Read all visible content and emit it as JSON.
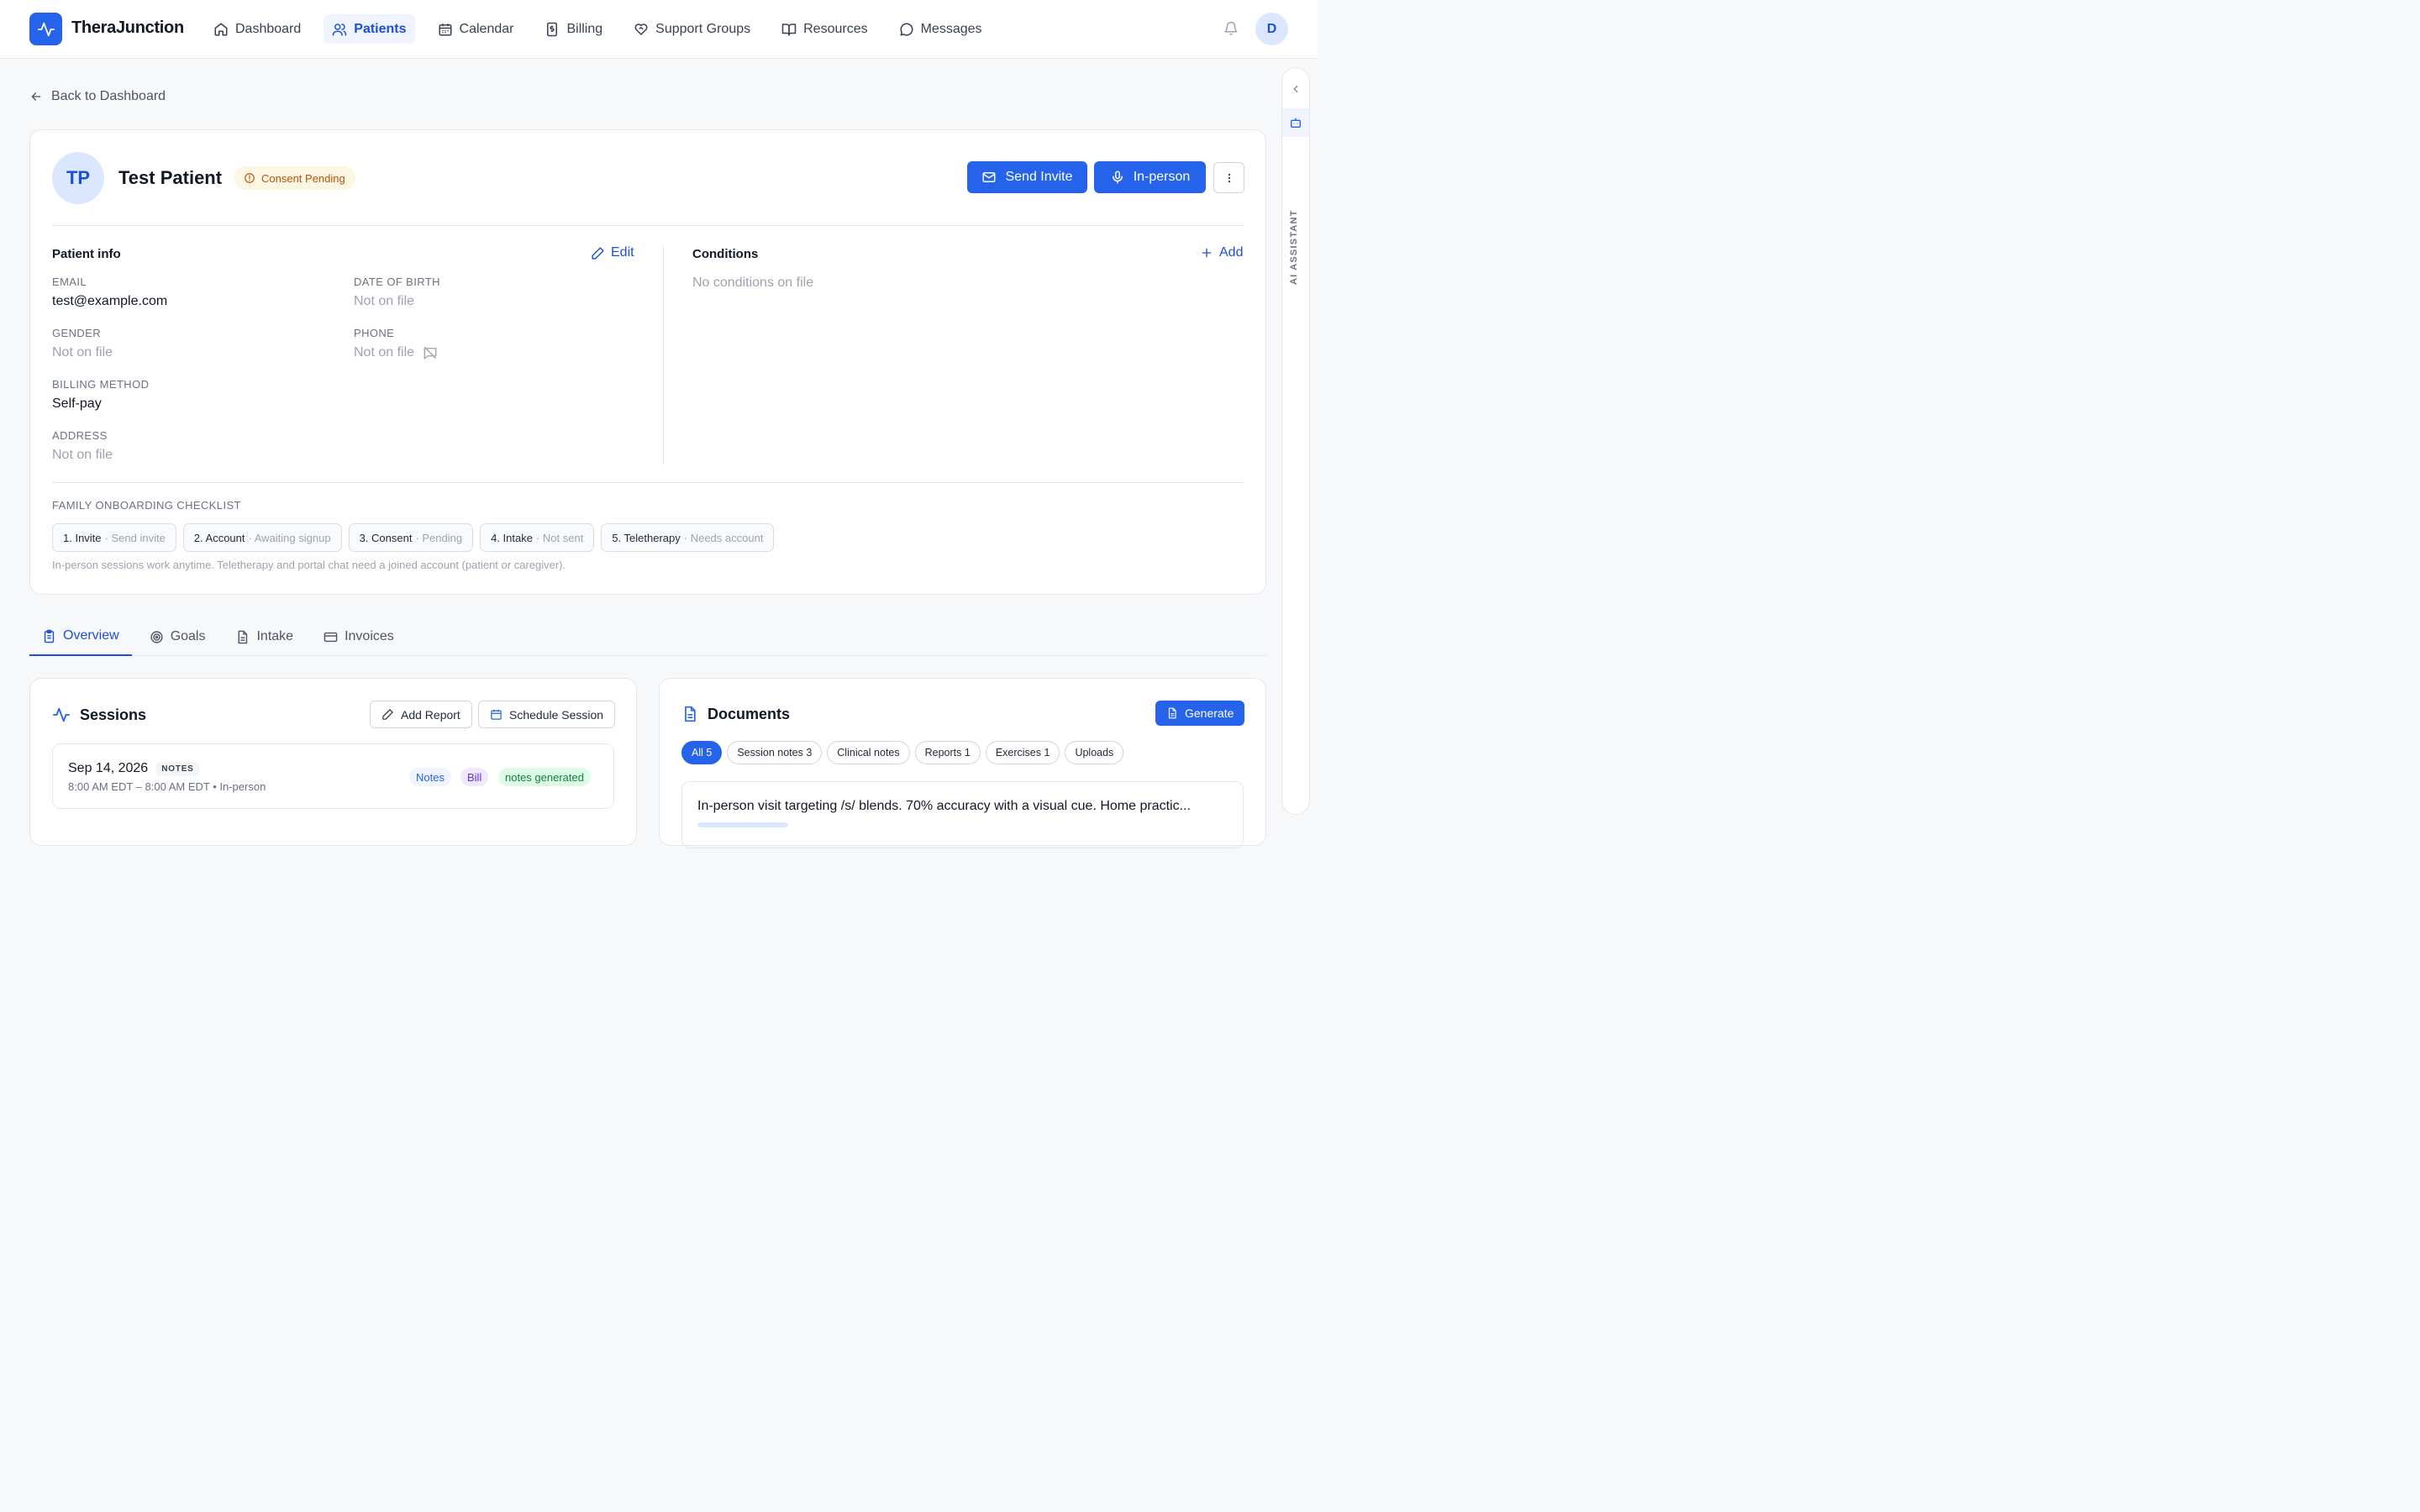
{
  "brand": {
    "name": "TheraJunction",
    "accent": "#2563eb"
  },
  "nav": {
    "items": [
      {
        "label": "Dashboard",
        "icon": "home-icon"
      },
      {
        "label": "Patients",
        "icon": "users-icon",
        "active": true
      },
      {
        "label": "Calendar",
        "icon": "calendar-icon"
      },
      {
        "label": "Billing",
        "icon": "receipt-icon"
      },
      {
        "label": "Support Groups",
        "icon": "handshake-heart-icon"
      },
      {
        "label": "Resources",
        "icon": "book-open-icon"
      },
      {
        "label": "Messages",
        "icon": "message-circle-icon"
      }
    ],
    "user_initial": "D"
  },
  "back_link": "Back to Dashboard",
  "side_panel": {
    "label": "AI ASSISTANT"
  },
  "patient": {
    "initials": "TP",
    "name": "Test Patient",
    "consent_status": "Consent Pending",
    "actions": {
      "send_invite": "Send Invite",
      "in_person": "In-person"
    }
  },
  "patient_info": {
    "title": "Patient info",
    "edit": "Edit",
    "fields": {
      "email_label": "EMAIL",
      "email": "test@example.com",
      "dob_label": "DATE OF BIRTH",
      "dob": "Not on file",
      "gender_label": "GENDER",
      "gender": "Not on file",
      "phone_label": "PHONE",
      "phone": "Not on file",
      "billing_label": "BILLING METHOD",
      "billing": "Self-pay",
      "address_label": "ADDRESS",
      "address": "Not on file"
    }
  },
  "conditions": {
    "title": "Conditions",
    "add": "Add",
    "empty": "No conditions on file"
  },
  "checklist": {
    "title": "FAMILY ONBOARDING CHECKLIST",
    "steps": [
      {
        "label": "1. Invite",
        "status": "· Send invite"
      },
      {
        "label": "2. Account",
        "status": "· Awaiting signup"
      },
      {
        "label": "3. Consent",
        "status": "· Pending"
      },
      {
        "label": "4. Intake",
        "status": "· Not sent"
      },
      {
        "label": "5. Teletherapy",
        "status": "· Needs account"
      }
    ],
    "help": "In-person sessions work anytime. Teletherapy and portal chat need a joined account (patient or caregiver)."
  },
  "tabs": [
    {
      "label": "Overview",
      "icon": "clipboard-icon",
      "active": true
    },
    {
      "label": "Goals",
      "icon": "target-icon"
    },
    {
      "label": "Intake",
      "icon": "file-text-icon"
    },
    {
      "label": "Invoices",
      "icon": "credit-card-icon"
    }
  ],
  "sessions": {
    "title": "Sessions",
    "add_report": "Add Report",
    "schedule": "Schedule Session",
    "rows": [
      {
        "date": "Sep 14, 2026",
        "badge": "NOTES",
        "time": "8:00 AM EDT – 8:00 AM EDT • In-person",
        "tags": [
          "Notes",
          "Bill",
          "notes generated"
        ]
      }
    ]
  },
  "documents": {
    "title": "Documents",
    "generate": "Generate",
    "filters": [
      "All 5",
      "Session notes 3",
      "Clinical notes",
      "Reports 1",
      "Exercises 1",
      "Uploads"
    ],
    "items": [
      {
        "text": "In-person visit targeting /s/ blends. 70% accuracy with a visual cue. Home practic..."
      }
    ]
  }
}
